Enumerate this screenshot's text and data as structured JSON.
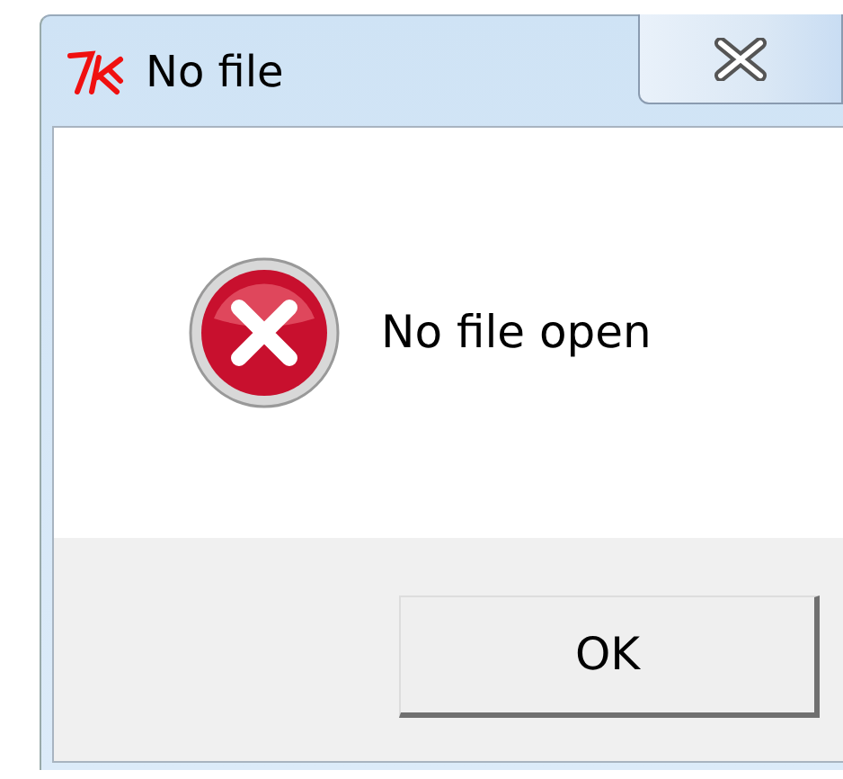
{
  "window": {
    "title": "No file"
  },
  "dialog": {
    "kind": "error",
    "message": "No file open"
  },
  "buttons": [
    {
      "label": "OK"
    }
  ]
}
